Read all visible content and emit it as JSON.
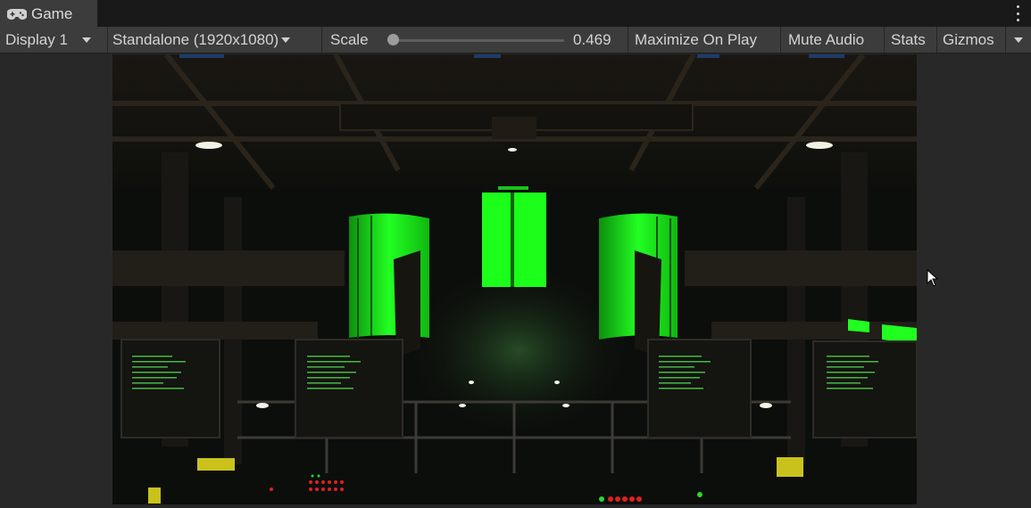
{
  "tab": {
    "title": "Game",
    "icon": "gamepad-icon"
  },
  "toolbar": {
    "display_label": "Display 1",
    "resolution_label": "Standalone (1920x1080)",
    "scale_label": "Scale",
    "scale_value": "0.469",
    "scale_fraction": 0.02,
    "maximize_label": "Maximize On Play",
    "mute_label": "Mute Audio",
    "stats_label": "Stats",
    "gizmos_label": "Gizmos"
  },
  "viewport": {
    "scene": "sci-fi reactor room with glowing green tanks and computer consoles",
    "accent_color": "#18ff18"
  },
  "colors": {
    "tab_strip": "#191919",
    "toolbar": "#3c3c3c",
    "background": "#282828"
  }
}
